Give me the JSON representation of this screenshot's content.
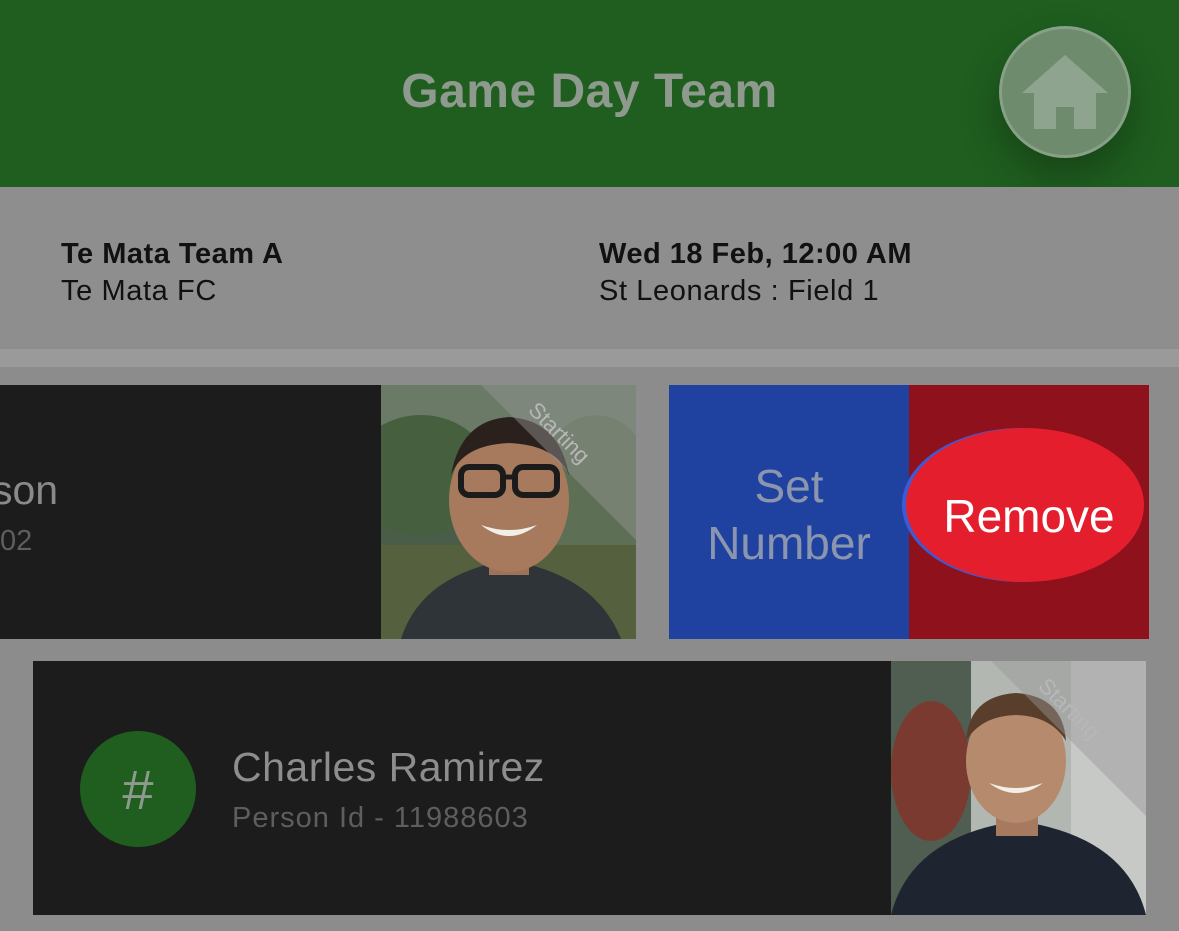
{
  "header": {
    "title": "Game Day Team"
  },
  "match": {
    "team_name": "Te Mata Team A",
    "club_name": "Te Mata FC",
    "date_time": "Wed 18 Feb, 12:00 AM",
    "venue": "St Leonards : Field 1"
  },
  "players": [
    {
      "name_fragment": "son",
      "id_fragment": "02",
      "status": "Starting"
    },
    {
      "number_symbol": "#",
      "name": "Charles Ramirez",
      "person_id": "Person Id - 11988603",
      "status": "Starting"
    }
  ],
  "actions": {
    "set_number_line1": "Set",
    "set_number_line2": "Number",
    "remove": "Remove"
  },
  "colors": {
    "header_green": "#1f5e1f",
    "set_number_blue": "#1f42a0",
    "remove_red": "#e51e2d",
    "remove_dark_red": "#8e111b",
    "card_dark": "#1c1c1c"
  }
}
